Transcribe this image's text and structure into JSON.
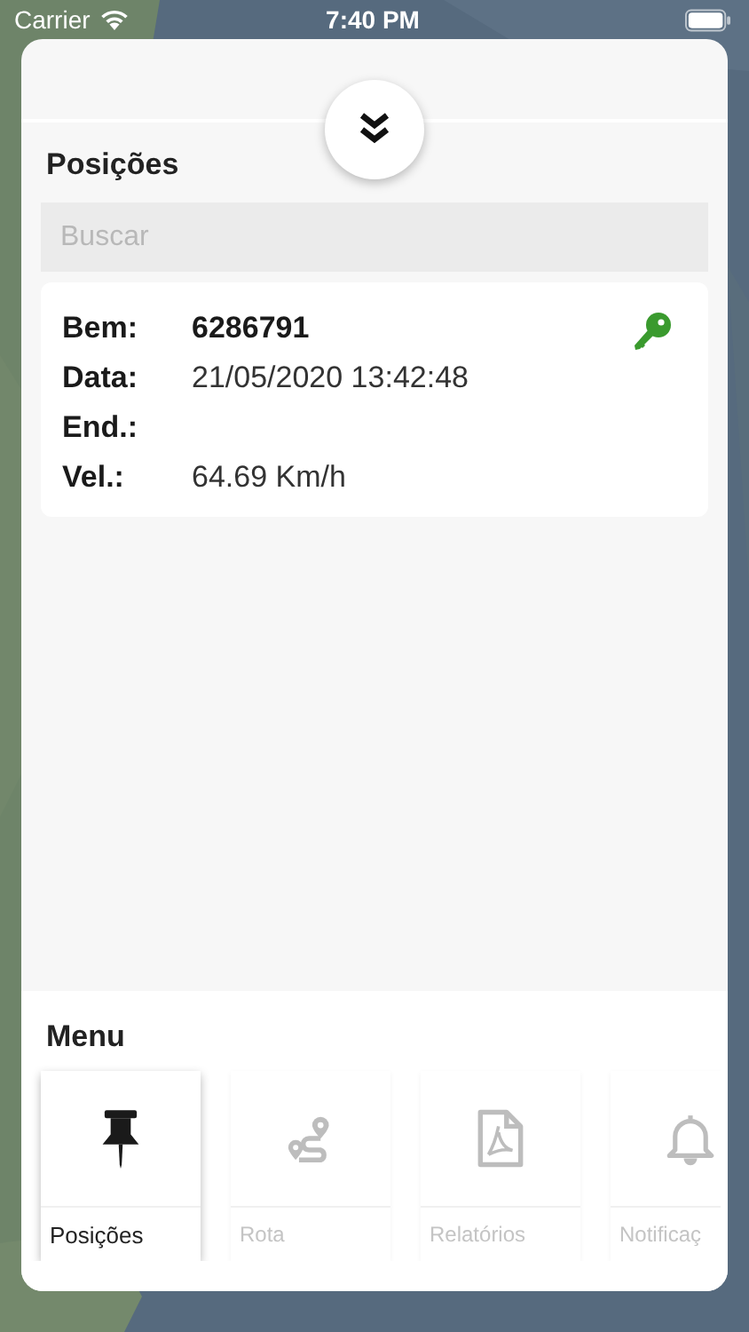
{
  "status_bar": {
    "carrier": "Carrier",
    "time": "7:40 PM"
  },
  "panel": {
    "title": "Posições",
    "search": {
      "placeholder": "Buscar"
    },
    "positions": [
      {
        "ignition_on": true,
        "fields": [
          {
            "label": "Bem:",
            "value": "6286791",
            "kind": "bold"
          },
          {
            "label": "Data:",
            "value": "21/05/2020 13:42:48",
            "kind": "plain"
          },
          {
            "label": "End.:"
          },
          {
            "label": "Vel.:",
            "value": "64.69 Km/h",
            "kind": "plain"
          }
        ]
      }
    ]
  },
  "menu": {
    "title": "Menu",
    "items": [
      {
        "label": "Posições",
        "kind": "pin",
        "selected": true
      },
      {
        "label": "Rota",
        "kind": "route",
        "selected": false
      },
      {
        "label": "Relatórios",
        "kind": "pdf",
        "selected": false
      },
      {
        "label": "Notificaç",
        "kind": "bell",
        "selected": false
      }
    ]
  }
}
